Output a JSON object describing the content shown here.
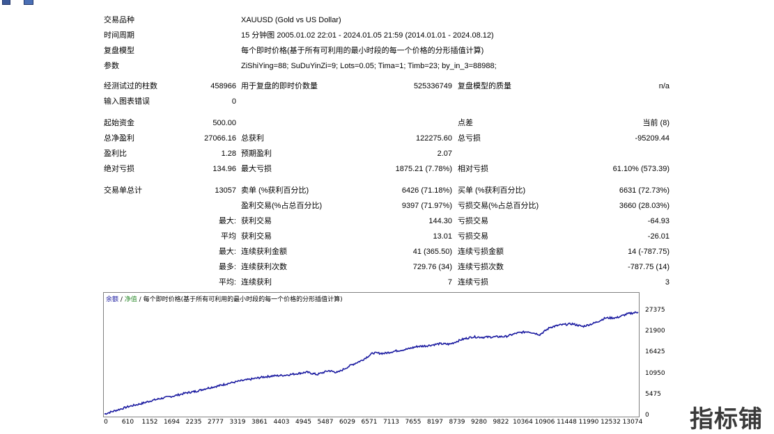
{
  "header": {
    "symbol_label": "交易品种",
    "symbol_value": "XAUUSD (Gold vs US Dollar)",
    "period_label": "时间周期",
    "period_value": "15 分钟图 2005.01.02 22:01 - 2024.01.05 21:59 (2014.01.01 - 2024.08.12)",
    "model_label": "复盘模型",
    "model_value": "每个即时价格(基于所有可利用的最小时段的每一个价格的分形插值计算)",
    "params_label": "参数",
    "params_value": "ZiShiYing=88; SuDuYinZi=9; Lots=0.05; Tima=1; Timb=23; by_in_3=88988;"
  },
  "stats": {
    "bars_label": "经测试过的柱数",
    "bars_value": "458966",
    "ticks_label": "用于复盘的即时价数量",
    "ticks_value": "525336749",
    "quality_label": "复盘模型的质量",
    "quality_value": "n/a",
    "errors_label": "输入图表错误",
    "errors_value": "0",
    "deposit_label": "起始资金",
    "deposit_value": "500.00",
    "spread_label": "点差",
    "spread_value": "当前 (8)",
    "net_label": "总净盈利",
    "net_value": "27066.16",
    "gross_profit_label": "总获利",
    "gross_profit_value": "122275.60",
    "gross_loss_label": "总亏损",
    "gross_loss_value": "-95209.44",
    "pf_label": "盈利比",
    "pf_value": "1.28",
    "expected_label": "预期盈利",
    "expected_value": "2.07",
    "abs_dd_label": "绝对亏损",
    "abs_dd_value": "134.96",
    "max_dd_label": "最大亏损",
    "max_dd_value": "1875.21 (7.78%)",
    "rel_dd_label": "相对亏损",
    "rel_dd_value": "61.10% (573.39)",
    "trades_label": "交易单总计",
    "trades_value": "13057",
    "short_label": "卖单 (%获利百分比)",
    "short_value": "6426 (71.18%)",
    "long_label": "买单 (%获利百分比)",
    "long_value": "6631 (72.73%)",
    "win_label": "盈利交易(%占总百分比)",
    "win_value": "9397 (71.97%)",
    "loss_label": "亏损交易(%占总百分比)",
    "loss_value": "3660 (28.03%)",
    "max1_label": "最大:",
    "largest_win_label": "获利交易",
    "largest_win_value": "144.30",
    "largest_loss_label": "亏损交易",
    "largest_loss_value": "-64.93",
    "avg1_label": "平均",
    "avg_win_label": "获利交易",
    "avg_win_value": "13.01",
    "avg_loss_label": "亏损交易",
    "avg_loss_value": "-26.01",
    "max2_label": "最大:",
    "cons_win_amt_label": "连续获利金额",
    "cons_win_amt_value": "41 (365.50)",
    "cons_loss_amt_label": "连续亏损金额",
    "cons_loss_amt_value": "14 (-787.75)",
    "most_label": "最多:",
    "cons_win_cnt_label": "连续获利次数",
    "cons_win_cnt_value": "729.76 (34)",
    "cons_loss_cnt_label": "连续亏损次数",
    "cons_loss_cnt_value": "-787.75 (14)",
    "avg2_label": "平均:",
    "avg_cons_win_label": "连续获利",
    "avg_cons_win_value": "7",
    "avg_cons_loss_label": "连续亏损",
    "avg_cons_loss_value": "3"
  },
  "chart_legend": {
    "balance": "余额",
    "sep1": " / ",
    "equity": "净值",
    "sep2": " / ",
    "model": "每个即时价格(基于所有可利用的最小时段的每一个价格的分形插值计算)"
  },
  "watermark": "指标铺",
  "colors": {
    "balance_line": "#1a1aa0",
    "equity_legend": "#2e8b2e",
    "frame": "#808080"
  },
  "chart_data": {
    "type": "line",
    "x_ticks": [
      "0",
      "610",
      "1152",
      "1694",
      "2235",
      "2777",
      "3319",
      "3861",
      "4403",
      "4945",
      "5487",
      "6029",
      "6571",
      "7113",
      "7655",
      "8197",
      "8739",
      "9280",
      "9822",
      "10364",
      "10906",
      "11448",
      "11990",
      "12532",
      "13074"
    ],
    "y_ticks": [
      "27375",
      "21900",
      "16425",
      "10950",
      "5475",
      "0"
    ],
    "xlim": [
      0,
      13057
    ],
    "ylim": [
      0,
      29000
    ],
    "series": [
      {
        "x": [
          0,
          300,
          610,
          900,
          1152,
          1400,
          1694,
          2000,
          2235,
          2500,
          2777,
          3000,
          3319,
          3600,
          3861,
          4100,
          4403,
          4700,
          4945,
          5200,
          5487,
          5700,
          6029,
          6300,
          6571,
          6850,
          7113,
          7400,
          7655,
          7900,
          8197,
          8450,
          8739,
          9000,
          9280,
          9550,
          9822,
          10100,
          10364,
          10650,
          10906,
          11150,
          11448,
          11700,
          11990,
          12250,
          12532,
          12800,
          13057
        ],
        "y": [
          500,
          1500,
          2500,
          3200,
          4000,
          4600,
          5200,
          6000,
          6400,
          7200,
          7800,
          8400,
          9100,
          9600,
          10100,
          10400,
          10600,
          11000,
          11400,
          10800,
          11800,
          11300,
          13200,
          14500,
          16400,
          16300,
          16900,
          17400,
          18100,
          18300,
          18800,
          18700,
          19900,
          20600,
          20500,
          20600,
          20700,
          21600,
          22000,
          21200,
          23100,
          23700,
          24000,
          23300,
          24200,
          25500,
          25600,
          26600,
          27066
        ]
      }
    ]
  }
}
